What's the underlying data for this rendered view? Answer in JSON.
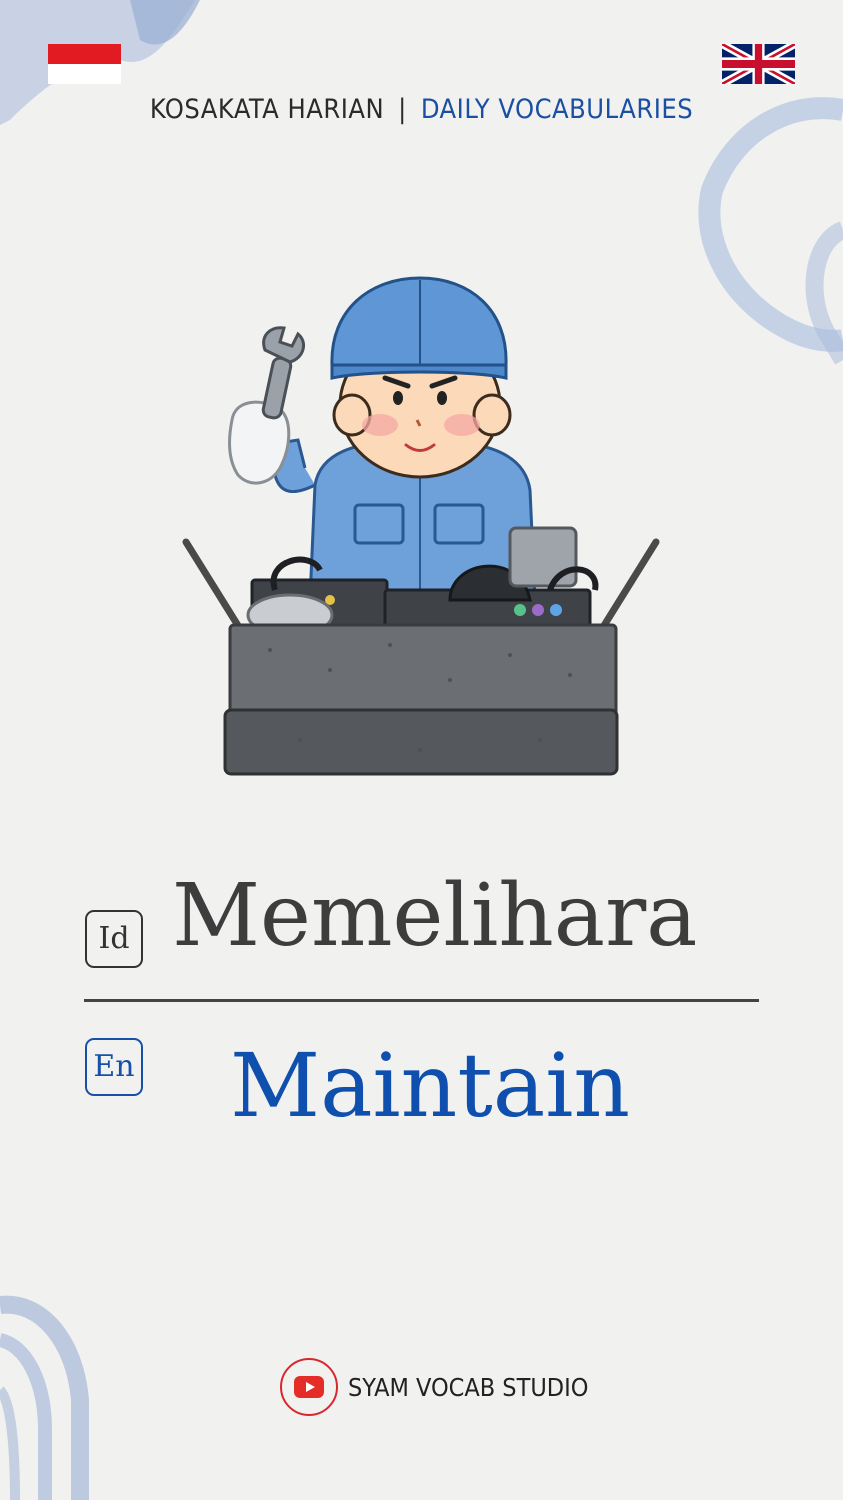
{
  "header": {
    "id_label": "KOSAKATA HARIAN",
    "separator": "|",
    "en_label": "DAILY VOCABULARIES"
  },
  "flags": {
    "left": "indonesia-flag-icon",
    "right": "united-kingdom-flag-icon"
  },
  "illustration": "mechanic-with-wrench-and-toolbox",
  "vocab": {
    "id_tag": "Id",
    "id_word": "Memelihara",
    "en_tag": "En",
    "en_word": "Maintain"
  },
  "footer": {
    "icon": "youtube-icon",
    "channel": "SYAM VOCAB STUDIO"
  },
  "colors": {
    "background": "#f1f1f0",
    "accent_blue": "#0f4fae",
    "text_dark": "#3d3d3d",
    "youtube_red": "#d7282f",
    "watercolor": "#9fb3d6"
  }
}
